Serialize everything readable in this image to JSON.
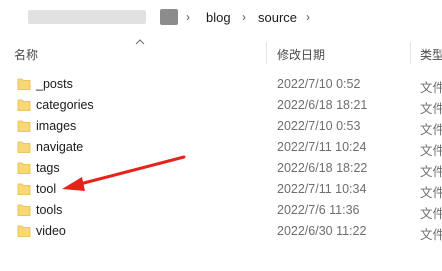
{
  "breadcrumb": {
    "items": [
      "blog",
      "source"
    ]
  },
  "columns": {
    "name": "名称",
    "date": "修改日期",
    "type": "类型"
  },
  "files": [
    {
      "name": "_posts",
      "date": "2022/7/10 0:52",
      "type": "文件"
    },
    {
      "name": "categories",
      "date": "2022/6/18 18:21",
      "type": "文件"
    },
    {
      "name": "images",
      "date": "2022/7/10 0:53",
      "type": "文件"
    },
    {
      "name": "navigate",
      "date": "2022/7/11 10:24",
      "type": "文件"
    },
    {
      "name": "tags",
      "date": "2022/6/18 18:22",
      "type": "文件"
    },
    {
      "name": "tool",
      "date": "2022/7/11 10:34",
      "type": "文件"
    },
    {
      "name": "tools",
      "date": "2022/7/6 11:36",
      "type": "文件"
    },
    {
      "name": "video",
      "date": "2022/6/30 11:22",
      "type": "文件"
    }
  ],
  "colors": {
    "folder": "#F8D775",
    "folder_dark": "#E9B949",
    "arrow": "#E8221B"
  },
  "icons": {
    "folder": "folder-icon",
    "chevron": "chevron-right-icon",
    "sort": "sort-ascending-icon",
    "annotation": "red-arrow-icon"
  }
}
